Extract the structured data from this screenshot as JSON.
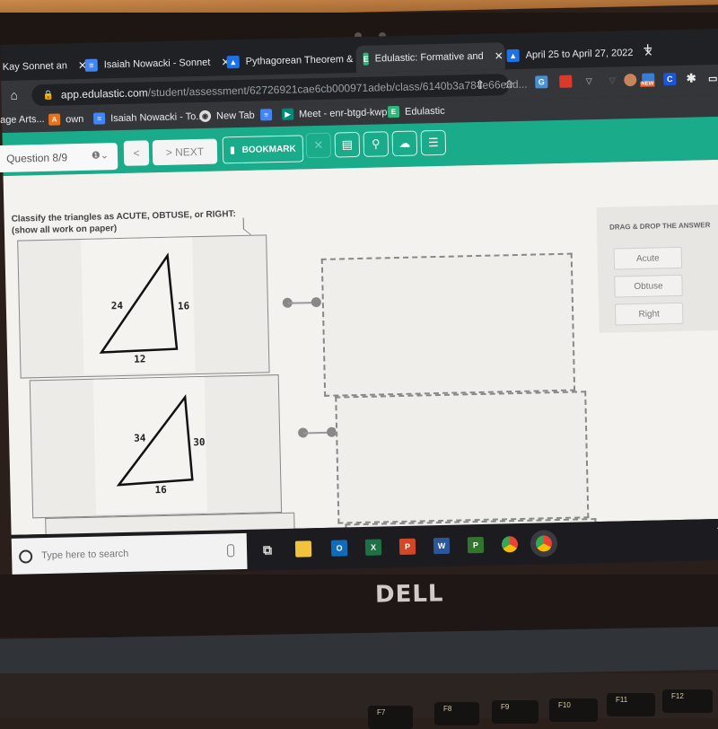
{
  "browser": {
    "tabs": [
      {
        "label": "Kay Sonnet an",
        "favicon": "doc-icon",
        "active": false
      },
      {
        "label": "Isaiah Nowacki - Sonnet",
        "favicon": "docs-icon",
        "active": false
      },
      {
        "label": "Pythagorean Theorem &",
        "favicon": "classroom-icon",
        "active": false
      },
      {
        "label": "Edulastic: Formative and",
        "favicon": "edulastic-icon",
        "active": true
      },
      {
        "label": "April 25 to April 27, 2022",
        "favicon": "classroom-icon",
        "active": false
      }
    ],
    "new_tab_label": "+",
    "url_host": "app.edulastic.com",
    "url_path": "/student/assessment/62726921cae6cb000971adeb/class/6140b3a784e66e8d...",
    "bookmarks": [
      {
        "label": "age Arts...",
        "favicon": ""
      },
      {
        "label": "own",
        "favicon": "A"
      },
      {
        "label": "Isaiah Nowacki - To...",
        "favicon": "docs-icon"
      },
      {
        "label": "New Tab",
        "favicon": "globe-icon"
      },
      {
        "label": "",
        "favicon": "docs-icon"
      },
      {
        "label": "Meet - enr-btgd-kwp",
        "favicon": "meet-icon"
      },
      {
        "label": "Edulastic",
        "favicon": "E"
      }
    ],
    "extension_badge": "NEW",
    "extension_c": "C"
  },
  "toolbar": {
    "question_selector": "Question 8/9",
    "prev_label": "<",
    "next_label": "> NEXT",
    "bookmark_label": "BOOKMARK",
    "colors": {
      "accent": "#1aab8b"
    }
  },
  "question": {
    "prompt_line1": "Classify the triangles as ACUTE, OBTUSE, or RIGHT:",
    "prompt_line2": "(show all work on paper)",
    "triangles": [
      {
        "left": "24",
        "right": "16",
        "bottom": "12"
      },
      {
        "left": "34",
        "right": "30",
        "bottom": "16"
      }
    ]
  },
  "answers": {
    "header": "DRAG & DROP THE ANSWER",
    "options": [
      "Acute",
      "Obtuse",
      "Right"
    ]
  },
  "taskbar": {
    "search_placeholder": "Type here to search",
    "apps": [
      "task-view",
      "file-explorer",
      "outlook",
      "excel",
      "powerpoint",
      "word",
      "project",
      "chrome",
      "chrome-profile"
    ]
  },
  "hardware": {
    "brand": "DELL",
    "function_keys": [
      "F7",
      "F8",
      "F9",
      "F10",
      "F11",
      "F12"
    ]
  }
}
